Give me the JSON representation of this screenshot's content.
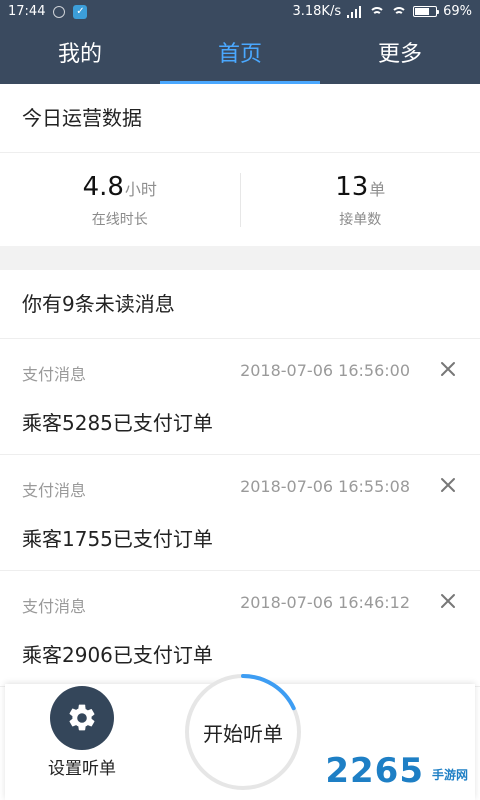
{
  "status_bar": {
    "time": "17:44",
    "network_speed": "3.18K/s",
    "battery": "69%",
    "battery_level": 0.69
  },
  "tabs": [
    {
      "label": "我的"
    },
    {
      "label": "首页",
      "active": true
    },
    {
      "label": "更多"
    }
  ],
  "operations": {
    "title": "今日运营数据",
    "online": {
      "value": "4.8",
      "unit": "小时",
      "label": "在线时长"
    },
    "orders": {
      "value": "13",
      "unit": "单",
      "label": "接单数"
    }
  },
  "messages": {
    "summary": "你有9条未读消息",
    "items": [
      {
        "type": "支付消息",
        "time": "2018-07-06 16:56:00",
        "text": "乘客5285已支付订单"
      },
      {
        "type": "支付消息",
        "time": "2018-07-06 16:55:08",
        "text": "乘客1755已支付订单"
      },
      {
        "type": "支付消息",
        "time": "2018-07-06 16:46:12",
        "text": "乘客2906已支付订单"
      }
    ]
  },
  "bottom": {
    "settings_label": "设置听单",
    "start_label": "开始听单",
    "start_progress": 0.18
  },
  "watermark": {
    "number": "2265",
    "text": "手游网"
  },
  "icons": {
    "settings": "gear-icon",
    "close": "close-icon"
  },
  "colors": {
    "header": "#3a4a5f",
    "accent": "#4aa8ff",
    "button": "#34465a",
    "watermark": "#1e7fc5"
  }
}
